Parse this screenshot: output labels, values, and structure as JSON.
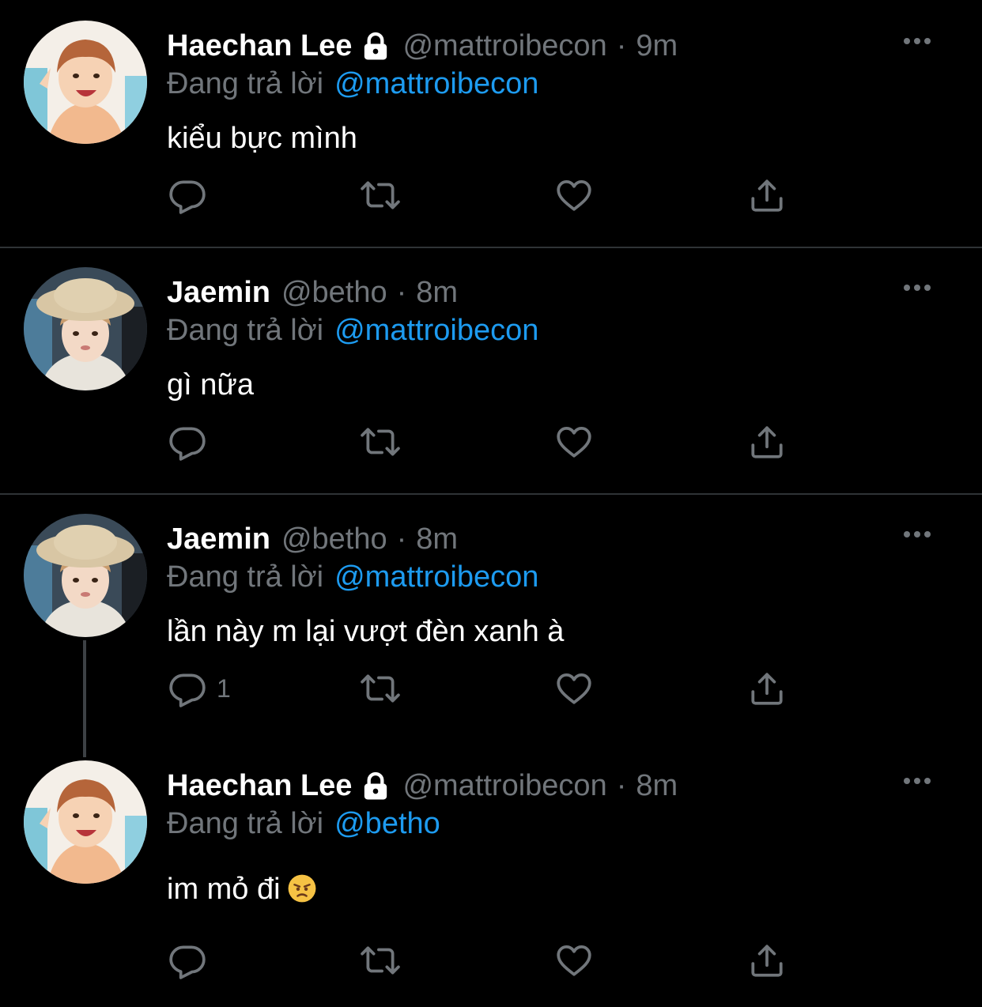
{
  "colors": {
    "background": "#000000",
    "primary_text": "#ffffff",
    "secondary_text": "#71767b",
    "link": "#1d9bf0",
    "divider": "#2f3336"
  },
  "replying_label": "Đang trả lời",
  "tweets": [
    {
      "name": "Haechan Lee",
      "locked": true,
      "handle": "@mattroibecon",
      "dot": "·",
      "time": "9m",
      "replying_to": "@mattroibecon",
      "text": "kiểu bực mình",
      "reply_count": "",
      "avatar": "haechan-avatar"
    },
    {
      "name": "Jaemin",
      "locked": false,
      "handle": "@betho",
      "dot": "·",
      "time": "8m",
      "replying_to": "@mattroibecon",
      "text": "gì nữa",
      "reply_count": "",
      "avatar": "jaemin-avatar"
    },
    {
      "name": "Jaemin",
      "locked": false,
      "handle": "@betho",
      "dot": "·",
      "time": "8m",
      "replying_to": "@mattroibecon",
      "text": "lần này m lại vượt đèn xanh à",
      "reply_count": "1",
      "avatar": "jaemin-avatar"
    },
    {
      "name": "Haechan Lee",
      "locked": true,
      "handle": "@mattroibecon",
      "dot": "·",
      "time": "8m",
      "replying_to": "@betho",
      "text": "im mỏ đi",
      "emoji": "angry-face-icon",
      "reply_count": "",
      "avatar": "haechan-avatar"
    }
  ],
  "icons": {
    "reply": "reply-icon",
    "retweet": "retweet-icon",
    "like": "heart-icon",
    "share": "share-icon",
    "more": "more-icon",
    "lock": "lock-icon"
  }
}
